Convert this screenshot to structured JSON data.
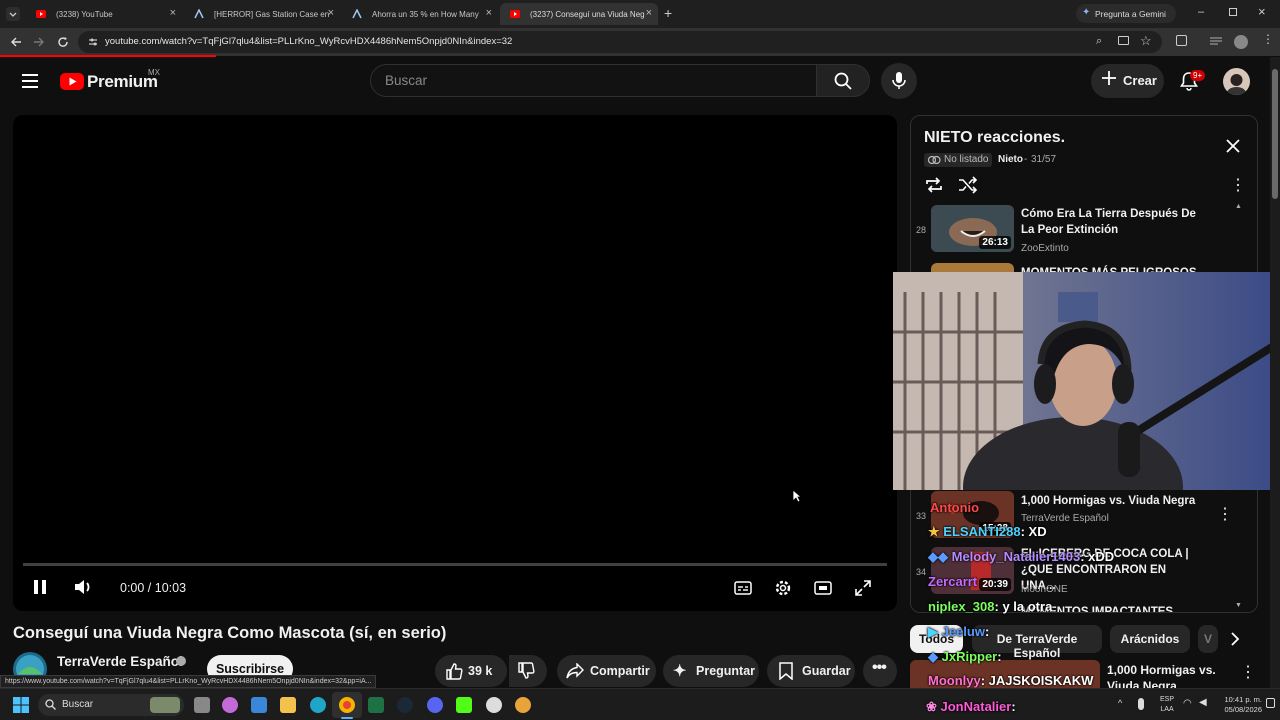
{
  "browser": {
    "tabs": [
      {
        "label": "(3238) YouTube",
        "favicon": "youtube-icon",
        "active": false
      },
      {
        "label": "[HERROR] Gas Station Case en",
        "favicon": "steam-icon",
        "active": false
      },
      {
        "label": "Ahorra un 35 % en How Many",
        "favicon": "steam-icon",
        "active": false
      },
      {
        "label": "(3237) Conseguí una Viuda Neg",
        "favicon": "youtube-icon",
        "active": true
      }
    ],
    "gemini_button": "Pregunta a Gemini",
    "url": "youtube.com/watch?v=TqFjGl7qlu4&list=PLLrKno_WyRcvHDX4486hNem5Onpjd0NIn&index=32"
  },
  "youtube": {
    "logo": "Premium",
    "country": "MX",
    "search_placeholder": "Buscar",
    "create_label": "Crear",
    "notifications_badge": "9+"
  },
  "player": {
    "time": "0:00 / 10:03",
    "progress": 0.0
  },
  "video": {
    "title": "Conseguí una Viuda Negra Como Mascota (sí, en serio)",
    "channel": "TerraVerde Español",
    "subscribe_label": "Suscribirse",
    "likes": "39 k",
    "share_label": "Compartir",
    "ask_label": "Preguntar",
    "save_label": "Guardar"
  },
  "status_url": "https://www.youtube.com/watch?v=TqFjGl7qlu4&list=PLLrKno_WyRcvHDX4486hNem5Onpjd0NIn&index=32&pp=iA...",
  "playlist": {
    "title": "NIETO reacciones.",
    "visibility": "No listado",
    "owner": "Nieto",
    "position": "31/57",
    "items": [
      {
        "index": "28",
        "title": "Cómo Era La Tierra Después De La Peor Extinción",
        "channel": "ZooExtinto",
        "duration": "26:13"
      },
      {
        "index": "",
        "title": "MOMENTOS MÁS PELIGROSOS",
        "channel": "",
        "duration": ""
      },
      {
        "index": "33",
        "title": "1,000 Hormigas vs. Viuda Negra",
        "channel": "TerraVerde Español",
        "duration": "15:28"
      },
      {
        "index": "34",
        "title": "EL ICEBERG DE COCA COLA | ¿QUE ENCONTRARON EN UNA...",
        "channel": "MoonONE",
        "duration": "20:39"
      },
      {
        "index": "",
        "title": "MOMENTOS IMPACTANTES",
        "channel": "",
        "duration": ""
      }
    ]
  },
  "chat": [
    {
      "user": "Antonio",
      "text": "",
      "color": "#ff4a4a"
    },
    {
      "user": "ELSANTI288",
      "text": ": XD",
      "color": "#4ad4ff"
    },
    {
      "user": "Melody_Natalier1403",
      "text": ": xDD",
      "color": "#b58cff"
    },
    {
      "user": "Zercarrt",
      "text": "",
      "color": "#c56bff"
    },
    {
      "user": "niplex_308",
      "text": ": y la otra",
      "color": "#7aff5c"
    },
    {
      "user": "Jeeluw",
      "text": ":",
      "color": "#5a9bff"
    },
    {
      "user": "JxRipper",
      "text": ":",
      "color": "#7aff5c"
    },
    {
      "user": "Moonlyy",
      "text": ": JAJSKOISKAKW",
      "color": "#ff70d0"
    },
    {
      "user": "JonNatalier",
      "text": ":",
      "color": "#ff5ad8"
    }
  ],
  "chips": [
    "Todos",
    "De TerraVerde Español",
    "Arácnidos",
    "V"
  ],
  "related": {
    "title": "1,000 Hormigas vs. Viuda Negra"
  },
  "taskbar": {
    "search_label": "Buscar",
    "lang": "ESP",
    "lang2": "LAA",
    "time": "10:41 p. m.",
    "date": "05/08/2026"
  },
  "colors": {
    "brand_red": "#ff0000",
    "background": "#0f0f0f",
    "panel": "#272727"
  }
}
